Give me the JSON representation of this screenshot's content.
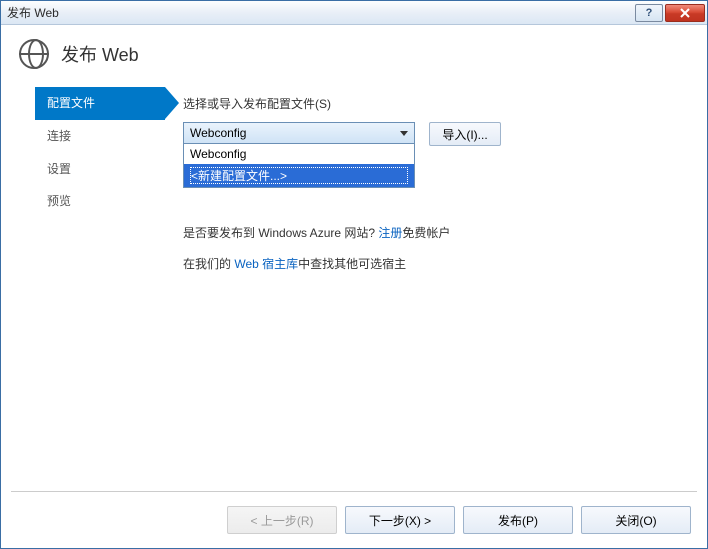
{
  "window": {
    "title": "发布 Web"
  },
  "header": {
    "title": "发布 Web"
  },
  "sidebar": {
    "items": [
      {
        "label": "配置文件",
        "active": true
      },
      {
        "label": "连接",
        "active": false
      },
      {
        "label": "设置",
        "active": false
      },
      {
        "label": "预览",
        "active": false
      }
    ]
  },
  "profile": {
    "label": "选择或导入发布配置文件(S)",
    "selected": "Webconfig",
    "options": [
      {
        "label": "Webconfig",
        "selected": false
      },
      {
        "label": "<新建配置文件...>",
        "selected": true
      }
    ],
    "import_label": "导入(I)..."
  },
  "azure": {
    "prefix": "是否要发布到 Windows Azure 网站? ",
    "link": "注册",
    "suffix": "免费帐户"
  },
  "host": {
    "prefix": "在我们的 ",
    "link": "Web 宿主库",
    "suffix": "中查找其他可选宿主"
  },
  "footer": {
    "prev": "< 上一步(R)",
    "next": "下一步(X) >",
    "publish": "发布(P)",
    "close": "关闭(O)"
  }
}
